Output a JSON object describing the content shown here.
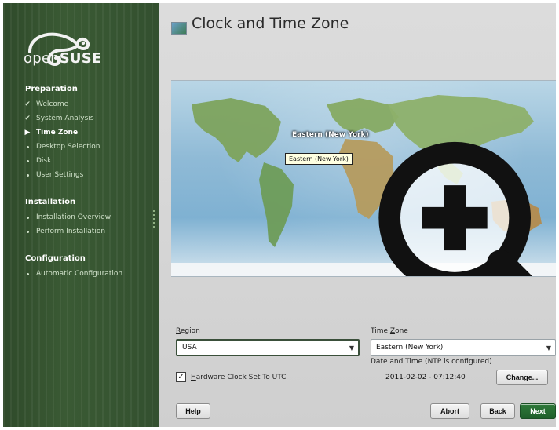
{
  "sidebar": {
    "logo_text_light": "open",
    "logo_text_bold": "SUSE",
    "sections": [
      {
        "title": "Preparation",
        "items": [
          {
            "label": "Welcome",
            "status": "done"
          },
          {
            "label": "System Analysis",
            "status": "done"
          },
          {
            "label": "Time Zone",
            "status": "current"
          },
          {
            "label": "Desktop Selection",
            "status": "pending"
          },
          {
            "label": "Disk",
            "status": "pending"
          },
          {
            "label": "User Settings",
            "status": "pending"
          }
        ]
      },
      {
        "title": "Installation",
        "items": [
          {
            "label": "Installation Overview",
            "status": "pending"
          },
          {
            "label": "Perform Installation",
            "status": "pending"
          }
        ]
      },
      {
        "title": "Configuration",
        "items": [
          {
            "label": "Automatic Configuration",
            "status": "pending"
          }
        ]
      }
    ]
  },
  "main": {
    "title": "Clock and Time Zone",
    "map": {
      "selected_label": "Eastern (New York)",
      "tooltip": "Eastern (New York)"
    },
    "region": {
      "label_pre": "",
      "label_mnemonic": "R",
      "label_post": "egion",
      "value": "USA"
    },
    "timezone": {
      "label_pre": "Time ",
      "label_mnemonic": "Z",
      "label_post": "one",
      "value": "Eastern (New York)"
    },
    "hardware_clock": {
      "checked": true,
      "label_mnemonic": "H",
      "label_post": "ardware Clock Set To UTC"
    },
    "datetime": {
      "caption": "Date and Time (NTP is configured)",
      "value": "2011-02-02 - 07:12:40"
    },
    "buttons": {
      "change": "Change...",
      "help": "Help",
      "abort": "Abort",
      "back": "Back",
      "next": "Next"
    }
  },
  "colors": {
    "sidebar_bg": "#3a5a34",
    "next_button": "#1f5f2b",
    "content_bg": "#dcdcdc"
  }
}
